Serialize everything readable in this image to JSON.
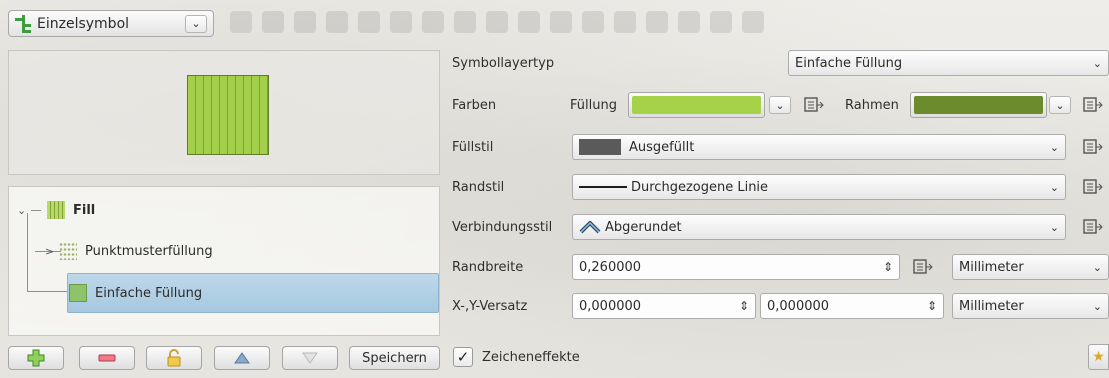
{
  "renderer": {
    "label": "Einzelsymbol"
  },
  "tree": {
    "items": [
      {
        "label": "Fill"
      },
      {
        "label": "Punktmusterfüllung"
      },
      {
        "label": "Einfache Füllung"
      }
    ]
  },
  "buttons": {
    "save_label": "Speichern"
  },
  "properties": {
    "symbol_layer_type": {
      "label": "Symbollayertyp",
      "value": "Einfache Füllung"
    },
    "colors": {
      "label": "Farben",
      "fill_label": "Füllung",
      "fill_color": "#a6d24a",
      "stroke_label": "Rahmen",
      "stroke_color": "#6c8b2c"
    },
    "fill_style": {
      "label": "Füllstil",
      "value": "Ausgefüllt",
      "swatch_color": "#5a5a5a"
    },
    "border_style": {
      "label": "Randstil",
      "value": "Durchgezogene Linie"
    },
    "join_style": {
      "label": "Verbindungsstil",
      "value": "Abgerundet"
    },
    "border_width": {
      "label": "Randbreite",
      "value": "0,260000",
      "unit": "Millimeter"
    },
    "offset": {
      "label": "X-,Y-Versatz",
      "x": "0,000000",
      "y": "0,000000",
      "unit": "Millimeter"
    }
  },
  "draw_effects": {
    "label": "Zeicheneffekte",
    "checked": true
  }
}
